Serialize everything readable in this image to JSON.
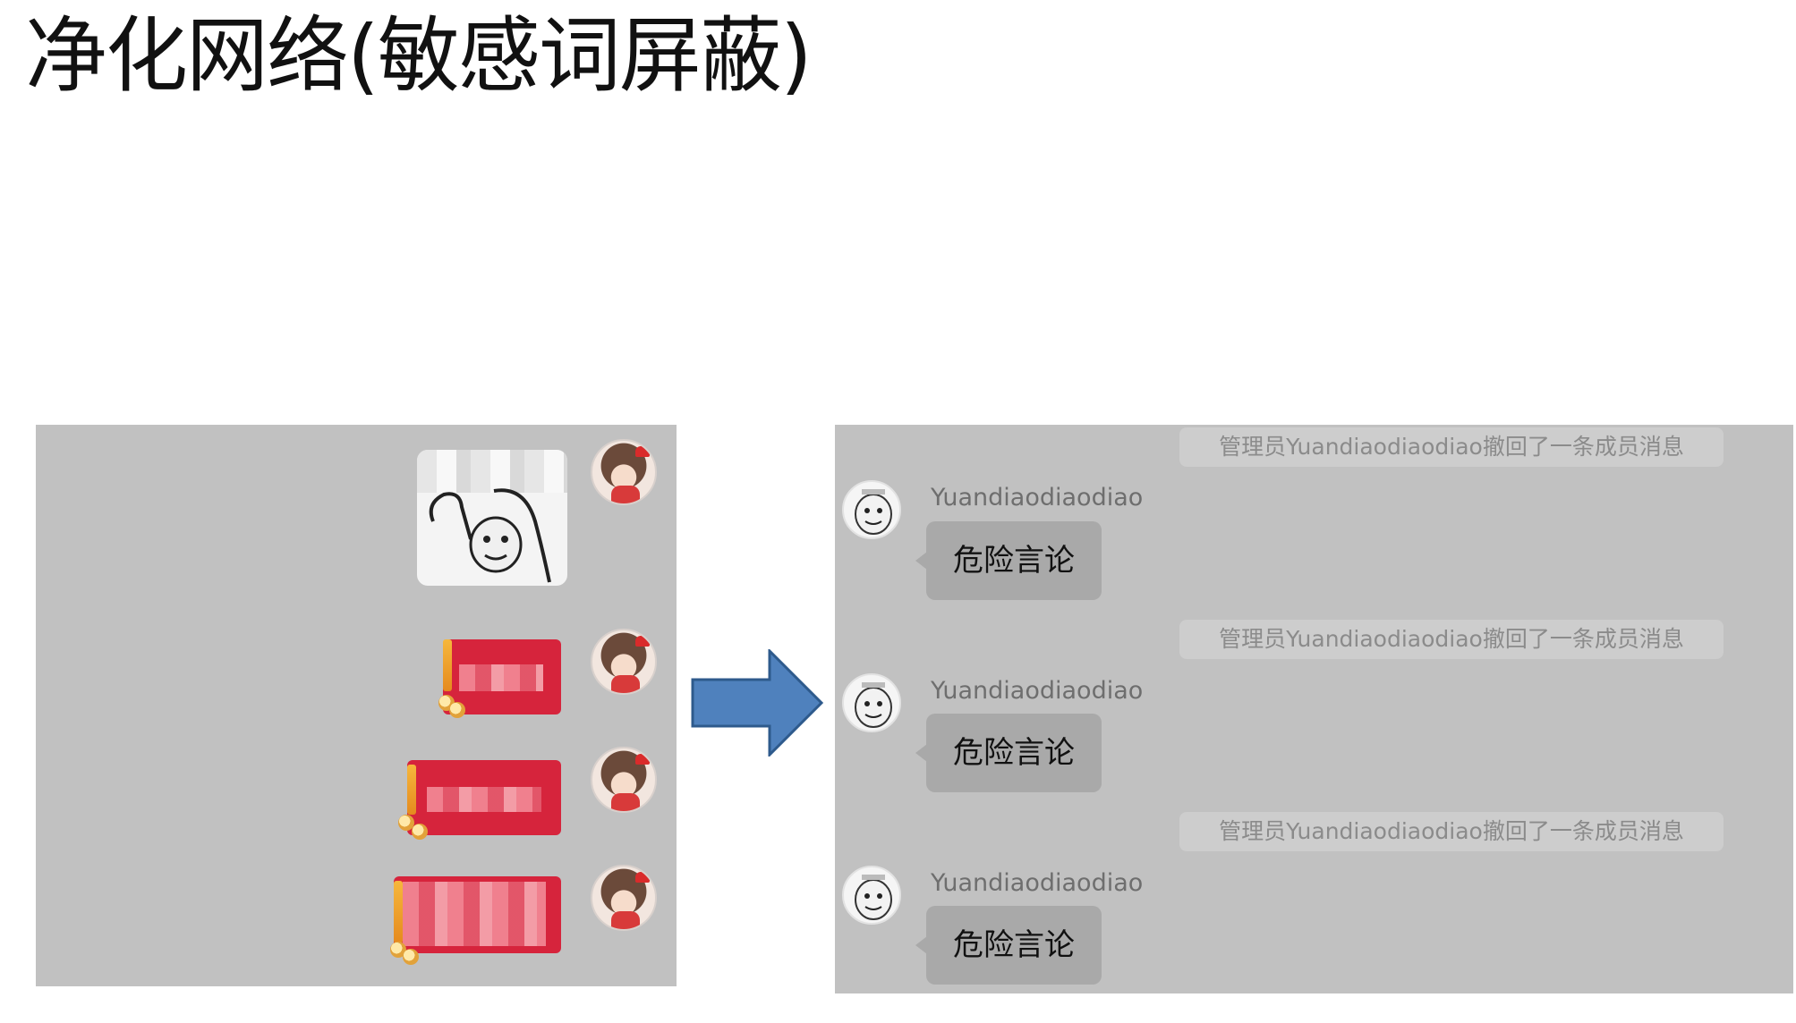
{
  "slide": {
    "title": "净化网络(敏感词屏蔽)"
  },
  "right_chat": {
    "messages": [
      {
        "notice": "管理员Yuandiaodiaodiao撤回了一条成员消息",
        "username": "Yuandiaodiaodiao",
        "text": "危险言论"
      },
      {
        "notice": "管理员Yuandiaodiaodiao撤回了一条成员消息",
        "username": "Yuandiaodiaodiao",
        "text": "危险言论"
      },
      {
        "notice": "管理员Yuandiaodiaodiao撤回了一条成员消息",
        "username": "Yuandiaodiaodiao",
        "text": "危险言论"
      }
    ]
  },
  "colors": {
    "panel_bg": "#c1c1c1",
    "bubble_bg": "#a9a9a9",
    "notice_bg": "#cdcdcd",
    "redpacket": "#d6243c",
    "arrow_fill": "#4f81bd",
    "arrow_stroke": "#2e5a8c"
  },
  "icons": {
    "left_avatar": "anime-girl-avatar",
    "right_avatar": "meme-face-avatar",
    "sticker": "meme-sticker",
    "arrow": "right-arrow-icon"
  }
}
